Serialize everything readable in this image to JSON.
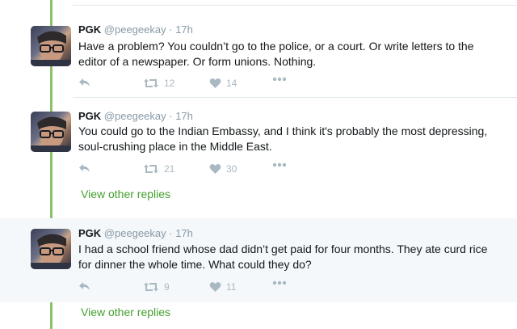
{
  "tweets": [
    {
      "name": "PGK",
      "handle": "@peegeekay",
      "time": "17h",
      "text": "Have a problem? You couldn’t go to the police, or a court. Or write letters to the editor of a newspaper. Or form unions. Nothing.",
      "retweets": "12",
      "likes": "14"
    },
    {
      "name": "PGK",
      "handle": "@peegeekay",
      "time": "17h",
      "text": "You could go to the Indian Embassy, and I think it's probably the most depressing, soul-crushing place in the Middle East.",
      "retweets": "21",
      "likes": "30"
    },
    {
      "name": "PGK",
      "handle": "@peegeekay",
      "time": "17h",
      "text": "I had a school friend whose dad didn’t get paid for four months. They ate curd rice for dinner the whole time. What could they do?",
      "retweets": "9",
      "likes": "11"
    }
  ],
  "view_other_replies": [
    "View other replies",
    "View other replies"
  ],
  "icons": {
    "reply": "reply-icon",
    "retweet": "retweet-icon",
    "like": "heart-icon",
    "more": "more-icon"
  },
  "colors": {
    "thread_line": "#8dc26a",
    "link": "#43a02e",
    "muted": "#8899a6",
    "action": "#aab8c2",
    "highlight_bg": "#f5f8fa"
  }
}
